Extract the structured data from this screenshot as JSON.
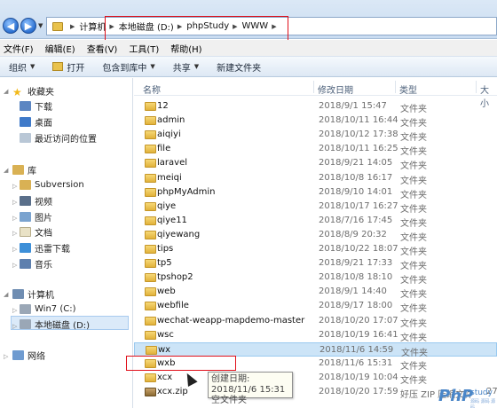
{
  "address_bar": {
    "crumbs": [
      "计算机",
      "本地磁盘 (D:)",
      "phpStudy",
      "WWW"
    ]
  },
  "menu": [
    "文件(F)",
    "编辑(E)",
    "查看(V)",
    "工具(T)",
    "帮助(H)"
  ],
  "toolbar": {
    "organize": "组织",
    "open": "打开",
    "include_in_library": "包含到库中",
    "share": "共享",
    "new_folder": "新建文件夹"
  },
  "nav": {
    "favorites": "收藏夹",
    "downloads": "下载",
    "desktop": "桌面",
    "recent": "最近访问的位置",
    "libraries": "库",
    "subversion": "Subversion",
    "videos": "视频",
    "pictures": "图片",
    "documents": "文档",
    "thunder": "迅雷下载",
    "music": "音乐",
    "computer": "计算机",
    "win7": "Win7 (C:)",
    "local_disk": "本地磁盘 (D:)",
    "network": "网络"
  },
  "columns": {
    "name": "名称",
    "modified": "修改日期",
    "type": "类型",
    "size": "大小"
  },
  "files": [
    {
      "name": "12",
      "date": "2018/9/1 15:47",
      "type": "文件夹",
      "size": ""
    },
    {
      "name": "admin",
      "date": "2018/10/11 16:44",
      "type": "文件夹",
      "size": ""
    },
    {
      "name": "aiqiyi",
      "date": "2018/10/12 17:38",
      "type": "文件夹",
      "size": ""
    },
    {
      "name": "file",
      "date": "2018/10/11 16:25",
      "type": "文件夹",
      "size": ""
    },
    {
      "name": "laravel",
      "date": "2018/9/21 14:05",
      "type": "文件夹",
      "size": ""
    },
    {
      "name": "meiqi",
      "date": "2018/10/8 16:17",
      "type": "文件夹",
      "size": ""
    },
    {
      "name": "phpMyAdmin",
      "date": "2018/9/10 14:01",
      "type": "文件夹",
      "size": ""
    },
    {
      "name": "qiye",
      "date": "2018/10/17 16:27",
      "type": "文件夹",
      "size": ""
    },
    {
      "name": "qiye11",
      "date": "2018/7/16 17:45",
      "type": "文件夹",
      "size": ""
    },
    {
      "name": "qiyewang",
      "date": "2018/8/9 20:32",
      "type": "文件夹",
      "size": ""
    },
    {
      "name": "tips",
      "date": "2018/10/22 18:07",
      "type": "文件夹",
      "size": ""
    },
    {
      "name": "tp5",
      "date": "2018/9/21 17:33",
      "type": "文件夹",
      "size": ""
    },
    {
      "name": "tpshop2",
      "date": "2018/10/8 18:10",
      "type": "文件夹",
      "size": ""
    },
    {
      "name": "web",
      "date": "2018/9/1 14:40",
      "type": "文件夹",
      "size": ""
    },
    {
      "name": "webfile",
      "date": "2018/9/17 18:00",
      "type": "文件夹",
      "size": ""
    },
    {
      "name": "wechat-weapp-mapdemo-master",
      "date": "2018/10/20 17:07",
      "type": "文件夹",
      "size": ""
    },
    {
      "name": "wsc",
      "date": "2018/10/19 16:41",
      "type": "文件夹",
      "size": ""
    },
    {
      "name": "wx",
      "date": "2018/11/6 14:59",
      "type": "文件夹",
      "size": ""
    },
    {
      "name": "wxb",
      "date": "2018/11/6 15:31",
      "type": "文件夹",
      "size": ""
    },
    {
      "name": "xcx",
      "date": "2018/10/19 10:04",
      "type": "文件夹",
      "size": ""
    },
    {
      "name": "xcx.zip",
      "date": "2018/10/20 17:59",
      "type": "好压 ZIP 压缩文件",
      "size": "27"
    }
  ],
  "tooltip": {
    "line1": "创建日期: 2018/11/6 15:31",
    "line2": "空文件夹"
  },
  "watermark": {
    "php": "PhP",
    "study": "study",
    "sub": "源码 源码 源码"
  },
  "colors": {
    "selection": "#cce4f7",
    "highlight_box": "#e0101a",
    "folder": "#e9c24c"
  }
}
